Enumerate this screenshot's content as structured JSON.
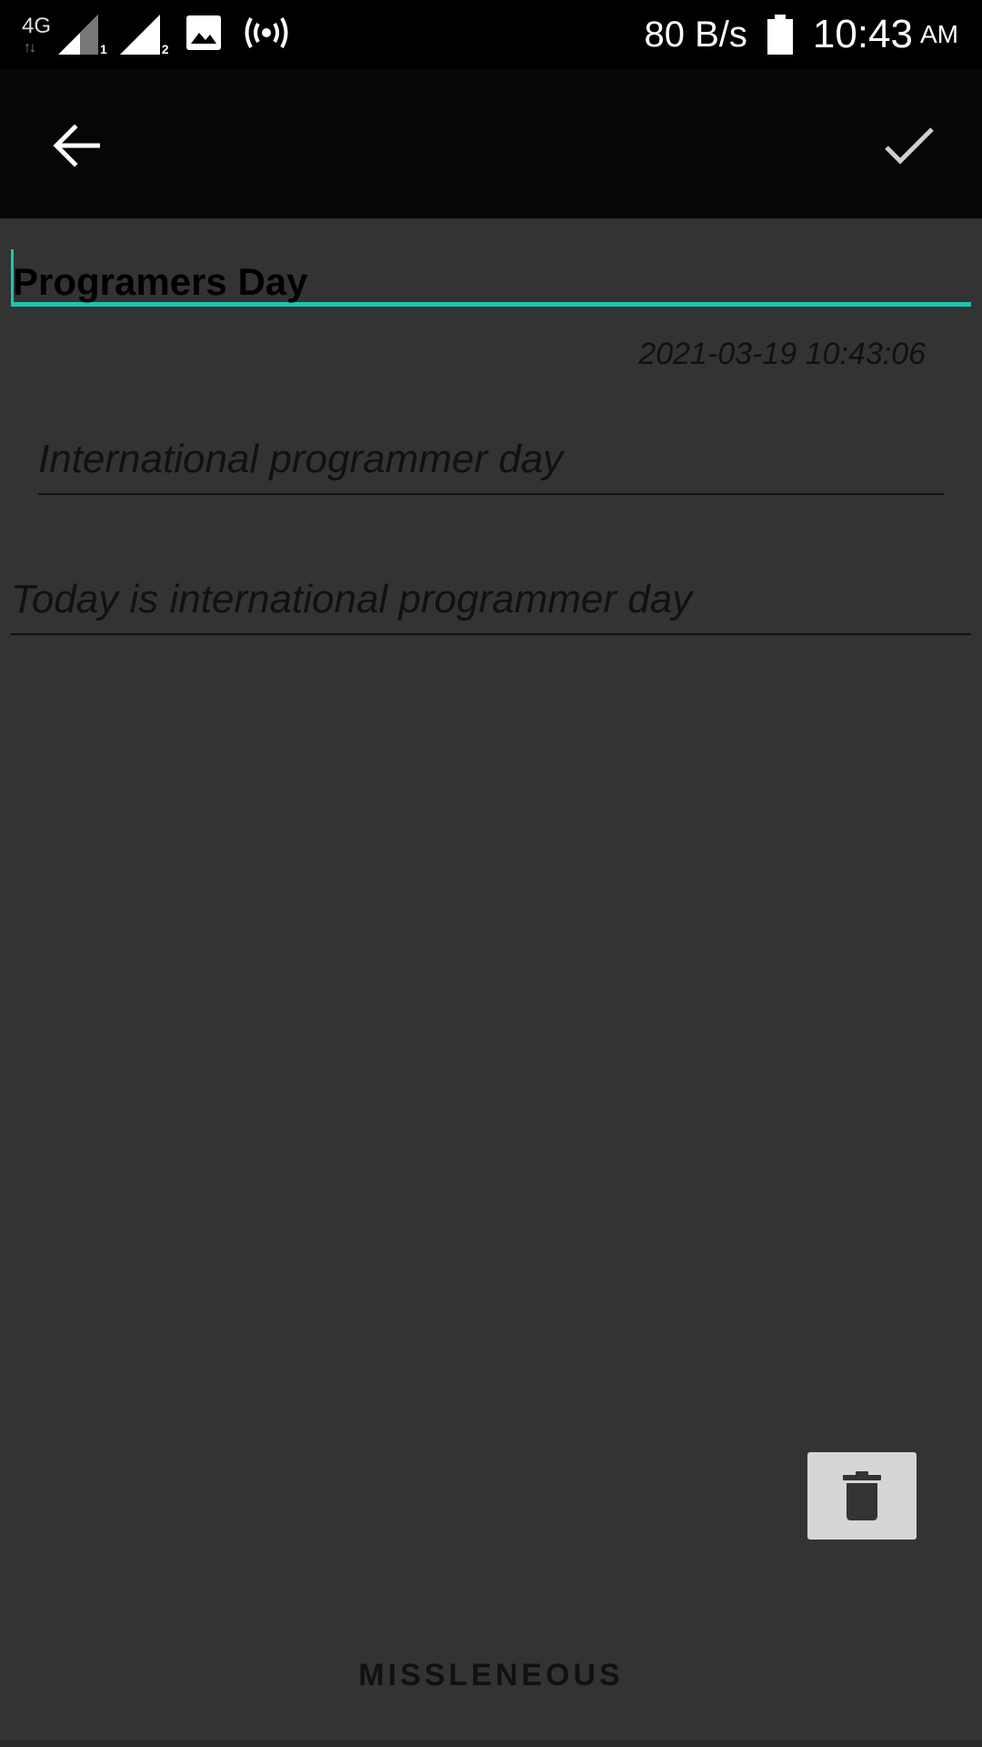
{
  "status_bar": {
    "network_type": "4G",
    "sim1_label": "1",
    "sim2_label": "2",
    "speed": "80 B/s",
    "time": "10:43",
    "ampm": "AM",
    "icons": [
      "signal-4g-icon",
      "signal-sim1-icon",
      "signal-sim2-icon",
      "image-icon",
      "hotspot-icon",
      "battery-icon"
    ]
  },
  "app_bar": {
    "back_icon": "arrow-back-icon",
    "confirm_icon": "check-icon"
  },
  "note": {
    "title": "Programers Day",
    "timestamp": "2021-03-19  10:43:06",
    "subtitle": "International programmer day",
    "body": "Today is international programmer day",
    "category": "MISSLENEOUS"
  },
  "actions": {
    "delete_icon": "trash-icon"
  },
  "colors": {
    "accent": "#1fc5b0",
    "background": "#333333",
    "app_bar": "#060606"
  }
}
